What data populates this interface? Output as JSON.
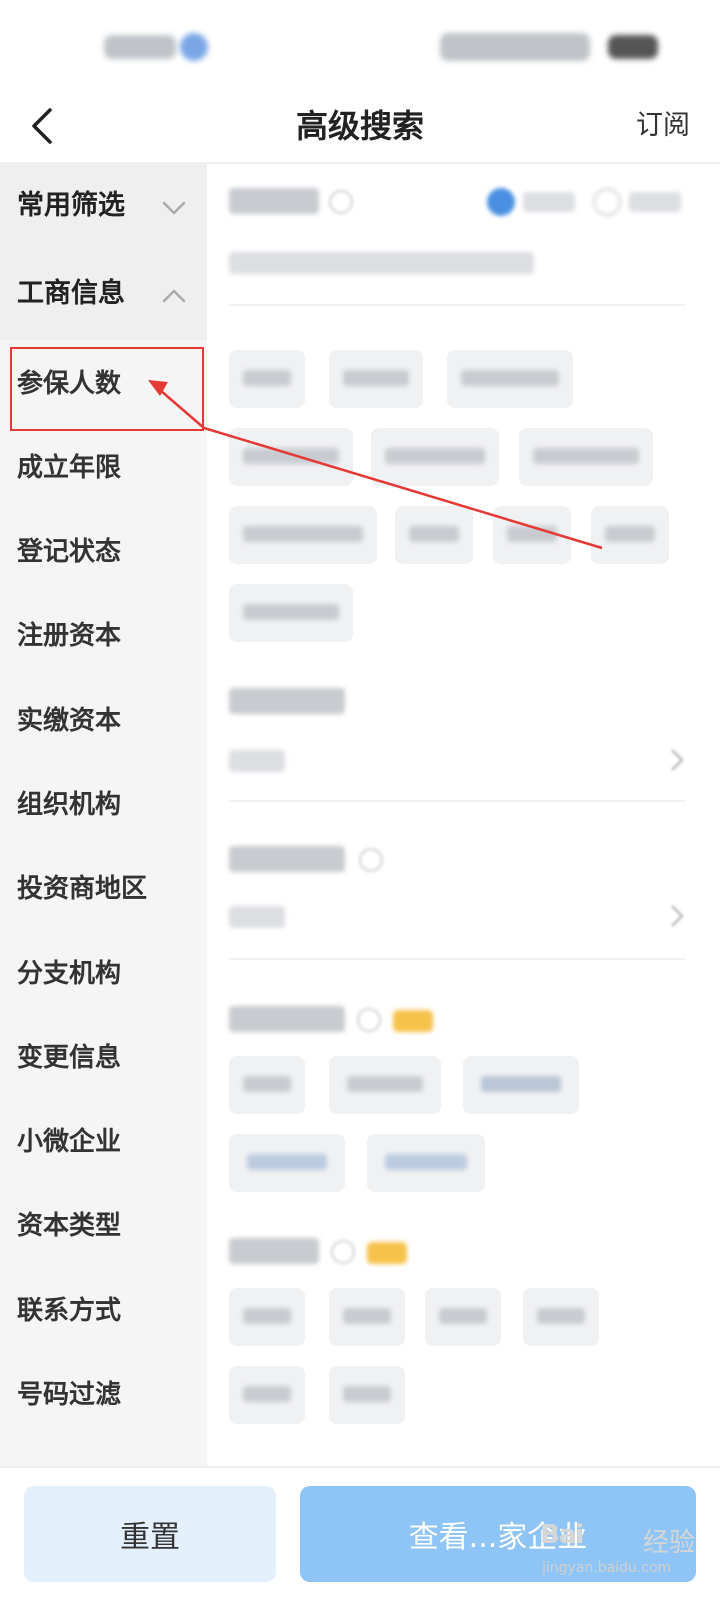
{
  "nav": {
    "title": "高级搜索",
    "subscribe_label": "订阅"
  },
  "sidebar": {
    "groups": [
      {
        "label": "常用筛选",
        "state": "collapsed"
      },
      {
        "label": "工商信息",
        "state": "expanded"
      }
    ],
    "items": [
      {
        "label": "参保人数",
        "highlighted": true
      },
      {
        "label": "成立年限"
      },
      {
        "label": "登记状态"
      },
      {
        "label": "注册资本"
      },
      {
        "label": "实缴资本"
      },
      {
        "label": "组织机构"
      },
      {
        "label": "投资商地区"
      },
      {
        "label": "分支机构"
      },
      {
        "label": "变更信息"
      },
      {
        "label": "小微企业"
      },
      {
        "label": "资本类型"
      },
      {
        "label": "联系方式"
      },
      {
        "label": "号码过滤"
      }
    ]
  },
  "footer": {
    "reset_label": "重置",
    "view_label": "查看...家企业"
  },
  "watermark": {
    "brand": "Bai",
    "suffix": "经验",
    "url": "jingyan.baidu.com"
  },
  "colors": {
    "accent": "#1e88e5",
    "button_blue": "#8ec5f6",
    "highlight_red": "#e53935",
    "sidebar_bg": "#f5f5f5"
  },
  "icons": {
    "back": "chevron-left-icon",
    "group_collapsed": "chevron-down-icon",
    "group_expanded": "chevron-up-icon",
    "annotation": "red-arrow-annotation"
  }
}
